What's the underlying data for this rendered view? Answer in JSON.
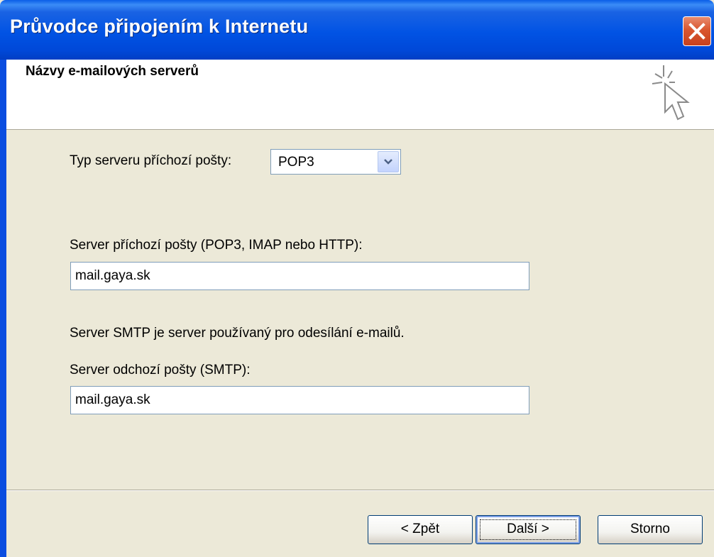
{
  "window": {
    "title": "Průvodce připojením k Internetu",
    "close_label": "×"
  },
  "header": {
    "title": "Názvy e-mailových serverů",
    "icon": "wizard-cursor-icon"
  },
  "form": {
    "server_type_label": "Typ serveru příchozí pošty:",
    "server_type_value": "POP3",
    "incoming_label": "Server příchozí pošty (POP3, IMAP nebo HTTP):",
    "incoming_value": "mail.gaya.sk",
    "smtp_note": "Server SMTP je server používaný pro odesílání e-mailů.",
    "outgoing_label": "Server odchozí pošty (SMTP):",
    "outgoing_value": "mail.gaya.sk"
  },
  "buttons": {
    "back": "< Zpět",
    "next": "Další >",
    "cancel": "Storno"
  },
  "colors": {
    "title_bar": "#0153e4",
    "dialog_bg": "#ece9d8",
    "close_button": "#d9562f"
  }
}
